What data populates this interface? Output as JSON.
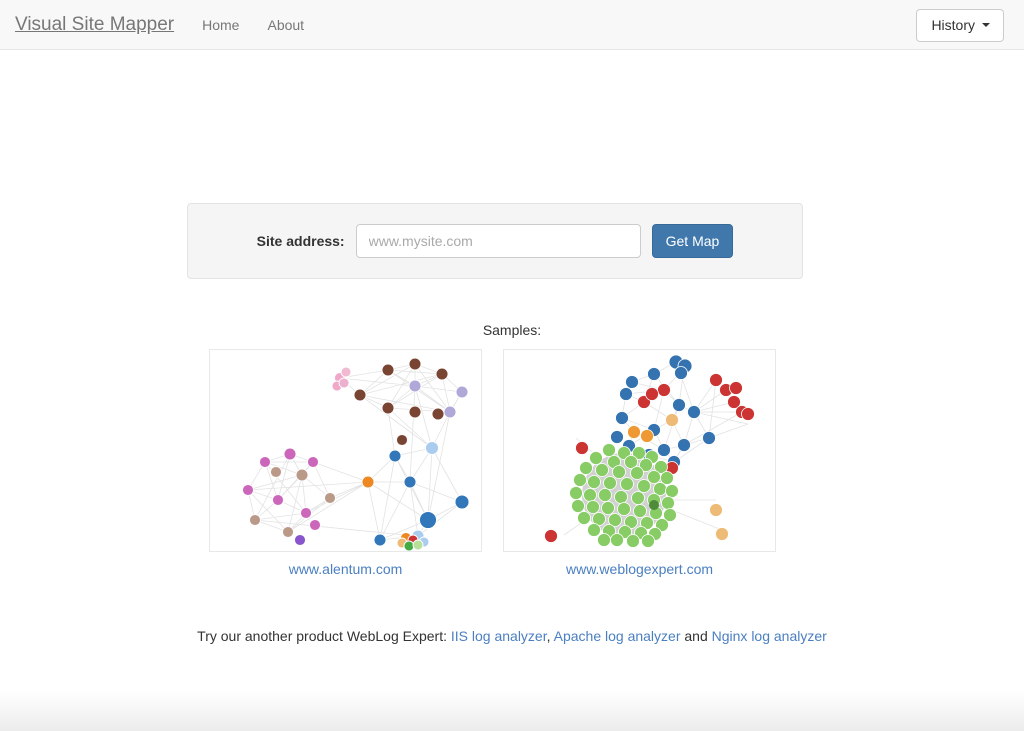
{
  "navbar": {
    "brand": "Visual Site Mapper",
    "links": [
      {
        "label": "Home",
        "name": "nav-link-home"
      },
      {
        "label": "About",
        "name": "nav-link-about"
      }
    ],
    "history_button": "History"
  },
  "form": {
    "label": "Site address:",
    "input_value": "",
    "input_placeholder": "www.mysite.com",
    "submit_label": "Get Map",
    "submit_color": "#4078ac"
  },
  "samples": {
    "title": "Samples:",
    "items": [
      {
        "caption": "www.alentum.com"
      },
      {
        "caption": "www.weblogexpert.com"
      }
    ]
  },
  "footer": {
    "prefix": "Try our another product WebLog Expert:",
    "link1": "IIS log analyzer",
    "separator1": ",",
    "link2": "Apache log analyzer",
    "conjunction": "and",
    "link3": "Nginx log analyzer",
    "link_color": "#4a7fc1"
  },
  "graphs": {
    "alentum": {
      "palette": {
        "magenta": "#cc66bb",
        "tan": "#bb9988",
        "orange": "#ee8822",
        "blue": "#3377bb",
        "purple": "#8855cc",
        "brown": "#7a4433",
        "pink": "#f0a8c8",
        "lavender": "#b0a8d8",
        "lightblue": "#aaccee",
        "green": "#44aa44",
        "red": "#cc3333",
        "edge": "#dddddd"
      },
      "node_count": 46,
      "cluster_count": 3
    },
    "weblogexpert": {
      "palette": {
        "blue": "#3573b0",
        "red": "#cc3333",
        "orange": "#ee9933",
        "peach": "#eebb77",
        "green": "#88cc66",
        "edge": "#dddddd"
      },
      "node_count": 120,
      "cluster_count": 3
    }
  }
}
